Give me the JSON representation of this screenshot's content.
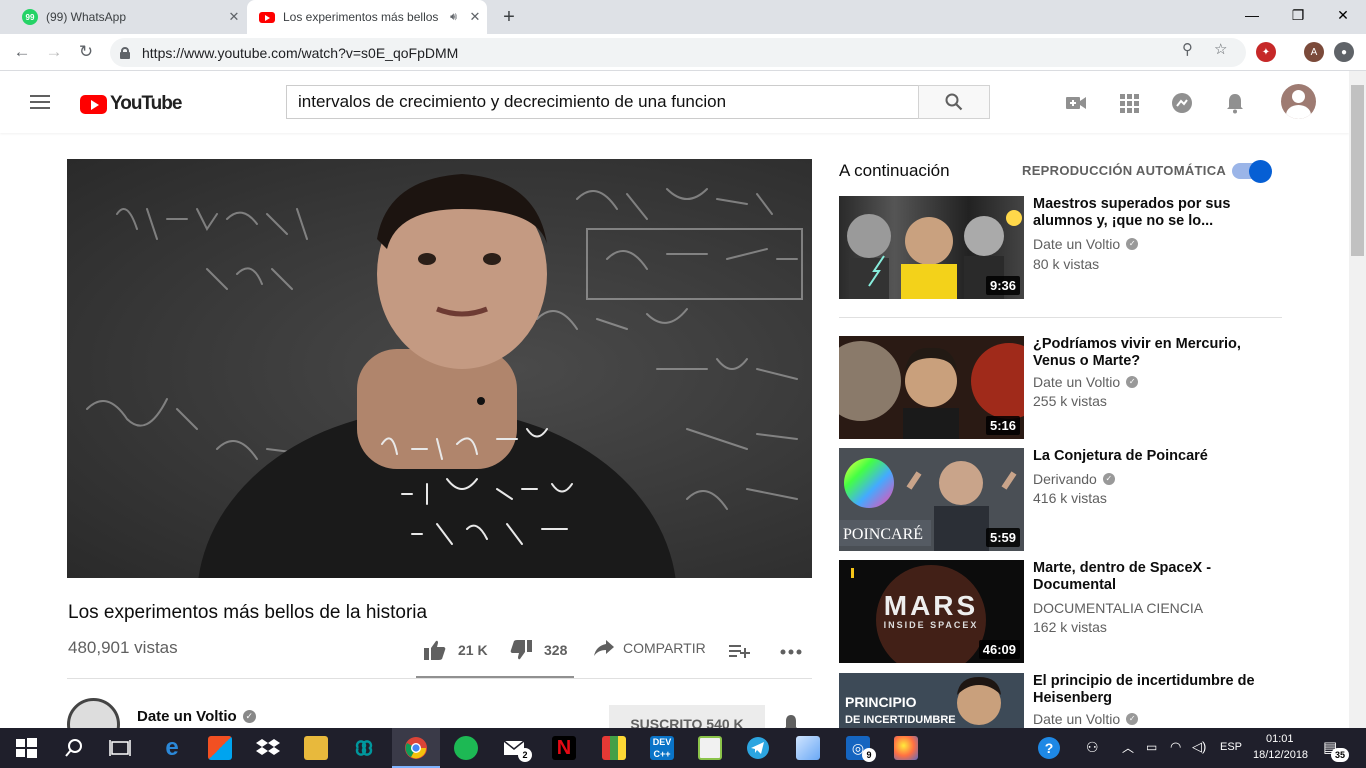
{
  "browser": {
    "tabs": [
      {
        "title": "(99) WhatsApp",
        "badge": "99"
      },
      {
        "title": "Los experimentos más bellos",
        "active": true
      }
    ],
    "new_tab": "+",
    "url": "https://www.youtube.com/watch?v=s0E_qoFpDMM",
    "profile_initial": "A"
  },
  "youtube": {
    "logo_text": "YouTube",
    "search_value": "intervalos de crecimiento y decrecimiento de una funcion",
    "video": {
      "title": "Los experimentos más bellos de la historia",
      "views": "480,901 vistas",
      "likes": "21 K",
      "dislikes": "328",
      "share_label": "COMPARTIR",
      "channel": "Date un Voltio",
      "subscribe_label": "SUSCRITO 540 K"
    },
    "sidebar": {
      "up_next_label": "A continuación",
      "autoplay_label": "REPRODUCCIÓN AUTOMÁTICA",
      "autoplay_on": true,
      "recommendations": [
        {
          "title": "Maestros superados por sus alumnos y, ¡que no se lo...",
          "channel": "Date un Voltio",
          "verified": true,
          "views": "80 k vistas",
          "duration": "9:36"
        },
        {
          "title": "¿Podríamos vivir en Mercurio, Venus o Marte?",
          "channel": "Date un Voltio",
          "verified": true,
          "views": "255 k vistas",
          "duration": "5:16"
        },
        {
          "title": "La Conjetura de Poincaré",
          "channel": "Derivando",
          "verified": true,
          "views": "416 k vistas",
          "duration": "5:59",
          "thumb_text": "POINCARÉ"
        },
        {
          "title": "Marte, dentro de SpaceX - Documental",
          "channel": "DOCUMENTALIA CIENCIA",
          "verified": false,
          "views": "162 k vistas",
          "duration": "46:09",
          "thumb_text": "MARS",
          "thumb_subtext": "INSIDE SPACEX"
        },
        {
          "title": "El principio de incertidumbre de Heisenberg",
          "channel": "Date un Voltio",
          "verified": true,
          "views": "",
          "duration": "",
          "thumb_text": "PRINCIPIO",
          "thumb_subtext": "DE INCERTIDUMBRE"
        }
      ]
    }
  },
  "taskbar": {
    "language": "ESP",
    "time": "01:01",
    "date": "18/12/2018",
    "notification_count": "35",
    "mail_badge": "2",
    "instagram_badge": "9"
  },
  "colors": {
    "youtube_red": "#ff0000",
    "toggle_blue": "#065fd4",
    "taskbar": "#1f1f2b"
  }
}
